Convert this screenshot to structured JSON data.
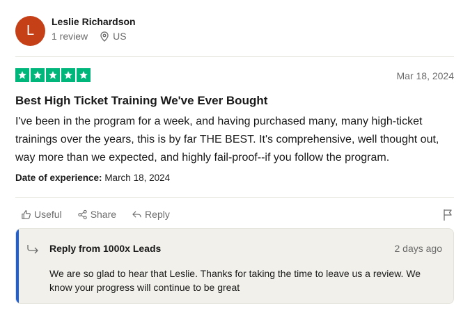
{
  "reviewer": {
    "initial": "L",
    "name": "Leslie Richardson",
    "review_count": "1 review",
    "location": "US",
    "avatar_color": "#c53f17"
  },
  "review": {
    "rating": 5,
    "star_color": "#00b67a",
    "date": "Mar 18, 2024",
    "title": "Best High Ticket Training We've Ever Bought",
    "lines": [
      "I've been in the program for a week, and having purchased many, many high-ticket",
      "trainings over the years, this is by far THE BEST. It's comprehensive, well thought out,",
      "way more than we expected, and highly fail-proof--if you follow the program."
    ],
    "experience_label": "Date of experience:",
    "experience_date": "March 18, 2024"
  },
  "actions": {
    "useful": "Useful",
    "share": "Share",
    "reply": "Reply"
  },
  "company_reply": {
    "from": "Reply from 1000x Leads",
    "date": "2 days ago",
    "lines": [
      "We are so glad to hear that Leslie. Thanks for taking the time to leave us a review. We",
      "know your progress will continue to be great"
    ],
    "accent_color": "#1c5fd6"
  }
}
